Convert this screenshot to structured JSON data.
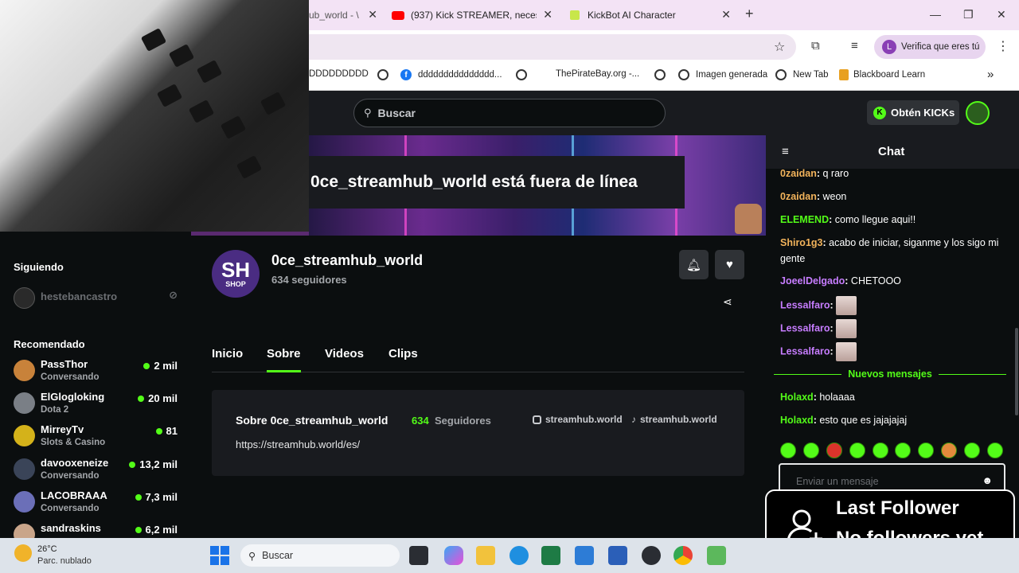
{
  "browser": {
    "tabs": [
      {
        "title": "ub_world - \\"
      },
      {
        "title": "(937) Kick STREAMER, necesitas"
      },
      {
        "title": "KickBot AI Character"
      }
    ],
    "new_tab": "+",
    "verify_label": "Verifica que eres tú",
    "verify_initial": "L",
    "bookmarks": [
      "DDDDDDDDD",
      "ddddddddddddddd...",
      "ThePirateBay.org -...",
      "Imagen generada",
      "New Tab",
      "Blackboard Learn"
    ],
    "more_bookmarks": "»"
  },
  "kick": {
    "search_placeholder": "Buscar",
    "get_kicks": "Obtén KICKs",
    "kicks_icon": "K"
  },
  "sidebar": {
    "following_title": "Siguiendo",
    "following": [
      {
        "name": "hestebancastro"
      }
    ],
    "recommended_title": "Recomendado",
    "recommended": [
      {
        "name": "PassThor",
        "category": "Conversando",
        "viewers": "2 mil",
        "color": "#c8823a"
      },
      {
        "name": "ElGlogloking",
        "category": "Dota 2",
        "viewers": "20 mil",
        "color": "#7a7f86"
      },
      {
        "name": "MirreyTv",
        "category": "Slots & Casino",
        "viewers": "81",
        "color": "#d4b21a"
      },
      {
        "name": "davooxeneize",
        "category": "Conversando",
        "viewers": "13,2 mil",
        "color": "#3a4458"
      },
      {
        "name": "LACOBRAAA",
        "category": "Conversando",
        "viewers": "7,3 mil",
        "color": "#6b6fb8"
      },
      {
        "name": "sandraskins",
        "category": "",
        "viewers": "6,2 mil",
        "color": "#c9a58a"
      }
    ]
  },
  "channel": {
    "offline_text": "0ce_streamhub_world está fuera de línea",
    "avatar_text": "SH",
    "avatar_sub": "SHOP",
    "name": "0ce_streamhub_world",
    "followers": "634 seguidores",
    "tabs": [
      "Inicio",
      "Sobre",
      "Videos",
      "Clips"
    ],
    "active_tab": "Sobre",
    "about_title": "Sobre 0ce_streamhub_world",
    "about_count": "634",
    "about_count_label": "Seguidores",
    "about_url": "https://streamhub.world/es/",
    "social_instagram": "streamhub.world",
    "social_tiktok": "streamhub.world"
  },
  "chat": {
    "title": "Chat",
    "messages": [
      {
        "user": "0zaidan",
        "color": "#f2b35b",
        "text": "q raro"
      },
      {
        "user": "0zaidan",
        "color": "#f2b35b",
        "text": "weon"
      },
      {
        "user": "ELEMEND",
        "color": "#53fc18",
        "text": "como llegue aqui!!"
      },
      {
        "user": "Shiro1g3",
        "color": "#f2b35b",
        "text": "acabo de iniciar, siganme y los sigo mi gente"
      },
      {
        "user": "JoeelDelgado",
        "color": "#c77dff",
        "text": "CHETOOO"
      },
      {
        "user": "Lessalfaro",
        "color": "#c77dff",
        "text": ""
      },
      {
        "user": "Lessalfaro",
        "color": "#c77dff",
        "text": ""
      },
      {
        "user": "Lessalfaro",
        "color": "#c77dff",
        "text": ""
      }
    ],
    "new_messages_label": "Nuevos mensajes",
    "new_messages": [
      {
        "user": "Holaxd",
        "color": "#53fc18",
        "text": "holaaaa"
      },
      {
        "user": "Holaxd",
        "color": "#53fc18",
        "text": "esto que es jajajajaj"
      }
    ],
    "input_placeholder": "Enviar un mensaje"
  },
  "follower_widget": {
    "line1": "Last Follower",
    "line2": "No followers yet"
  },
  "taskbar": {
    "temperature": "26°C",
    "weather": "Parc. nublado",
    "search_placeholder": "Buscar"
  }
}
